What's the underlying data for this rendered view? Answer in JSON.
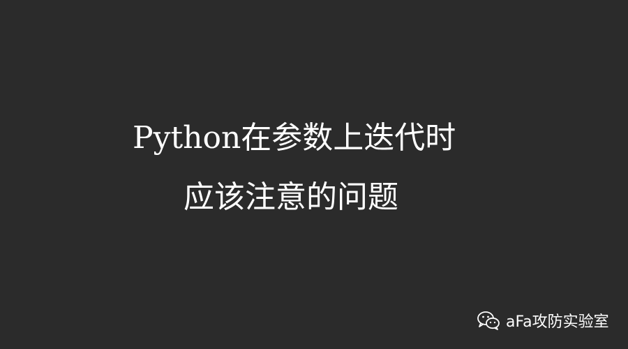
{
  "cover": {
    "title_line_1": "Python在参数上迭代时",
    "title_line_2": "应该注意的问题"
  },
  "watermark": {
    "icon": "wechat-icon",
    "label": "aFa攻防实验室"
  },
  "colors": {
    "background": "#2b2b2b",
    "text": "#ffffff"
  }
}
